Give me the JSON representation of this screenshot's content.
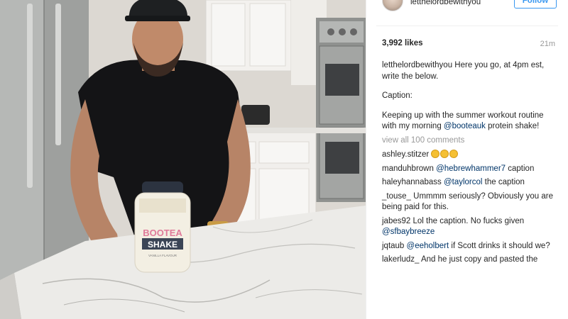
{
  "post": {
    "username": "letthelordbewithyou",
    "follow_label": "Follow",
    "likes": "3,992 likes",
    "time": "21m"
  },
  "photo": {
    "jar_label_top": "BOOTEA",
    "jar_label_main": "SHAKE",
    "jar_label_sub": "VANILLA FLAVOUR"
  },
  "caption": {
    "user": "letthelordbewithyou",
    "line1": "Here you go, at 4pm est, write the below.",
    "line2": "Caption:",
    "line3_pre": "Keeping up with the summer workout routine with my morning ",
    "line3_mention": "@booteauk",
    "line3_post": " protein shake!"
  },
  "view_all": "view all 100 comments",
  "comments": [
    {
      "user": "ashley.stitzer",
      "pre": "",
      "mention": "",
      "post": ""
    },
    {
      "user": "manduhbrown",
      "pre": "",
      "mention": "@hebrewhammer7",
      "post": " caption"
    },
    {
      "user": "haleyhannabass",
      "pre": "",
      "mention": "@taylorcol",
      "post": " the caption"
    },
    {
      "user": "_touse_",
      "pre": "Ummmm seriously? Obviously you are being paid for this.",
      "mention": "",
      "post": ""
    },
    {
      "user": "jabes92",
      "pre": "Lol the caption. No fucks given ",
      "mention": "@sfbaybreeze",
      "post": ""
    },
    {
      "user": "jqtaub",
      "pre": "",
      "mention": "@eeholbert",
      "post": " if Scott drinks it should we?"
    },
    {
      "user": "lakerludz_",
      "pre": "And he just copy and pasted the",
      "mention": "",
      "post": ""
    }
  ],
  "colors": {
    "link": "#003569",
    "follow": "#3897f0",
    "muted": "#999999"
  }
}
